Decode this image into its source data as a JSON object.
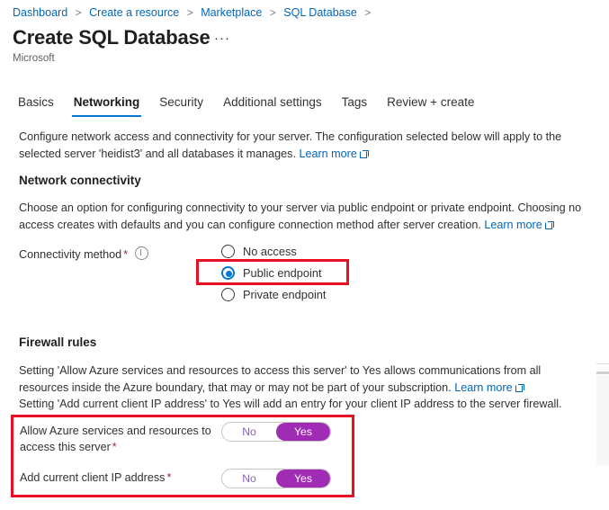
{
  "breadcrumb": {
    "items": [
      "Dashboard",
      "Create a resource",
      "Marketplace",
      "SQL Database"
    ],
    "separator": ">"
  },
  "header": {
    "title": "Create SQL Database",
    "ellipsis": "···",
    "publisher": "Microsoft"
  },
  "tabs": [
    {
      "label": "Basics",
      "active": false
    },
    {
      "label": "Networking",
      "active": true
    },
    {
      "label": "Security",
      "active": false
    },
    {
      "label": "Additional settings",
      "active": false
    },
    {
      "label": "Tags",
      "active": false
    },
    {
      "label": "Review + create",
      "active": false
    }
  ],
  "networking": {
    "description_1": "Configure network access and connectivity for your server. The configuration selected below will apply to the selected",
    "description_2": "server 'heidist3' and all databases it manages.",
    "learn_more": "Learn more"
  },
  "network_connectivity": {
    "heading": "Network connectivity",
    "description_1": "Choose an option for configuring connectivity to your server via public endpoint or private endpoint. Choosing no access",
    "description_2": "creates with defaults and you can configure connection method after server creation.",
    "learn_more": "Learn more",
    "field_label": "Connectivity method",
    "required_mark": "*",
    "options": [
      {
        "label": "No access",
        "selected": false
      },
      {
        "label": "Public endpoint",
        "selected": true
      },
      {
        "label": "Private endpoint",
        "selected": false
      }
    ]
  },
  "firewall": {
    "heading": "Firewall rules",
    "description_1": "Setting 'Allow Azure services and resources to access this server' to Yes allows communications from all resources inside",
    "description_2": "the Azure boundary, that may or may not be part of your subscription.",
    "learn_more": "Learn more",
    "description_3": "Setting 'Add current client IP address' to Yes will add an entry for your client IP address to the server firewall.",
    "toggles": [
      {
        "label": "Allow Azure services and resources to access this server",
        "required_mark": "*",
        "off_label": "No",
        "on_label": "Yes",
        "value": "Yes"
      },
      {
        "label": "Add current client IP address",
        "required_mark": "*",
        "off_label": "No",
        "on_label": "Yes",
        "value": "Yes"
      }
    ]
  },
  "annotations": {
    "color": "#e81123",
    "targets": [
      "public-endpoint-radio",
      "firewall-toggles"
    ]
  },
  "colors": {
    "link": "#0066bb",
    "accent": "#0078d4",
    "toggle_on": "#a02bb5",
    "toggle_off_text": "#8764b8",
    "required": "#a4262c",
    "annotation": "#e81123"
  }
}
